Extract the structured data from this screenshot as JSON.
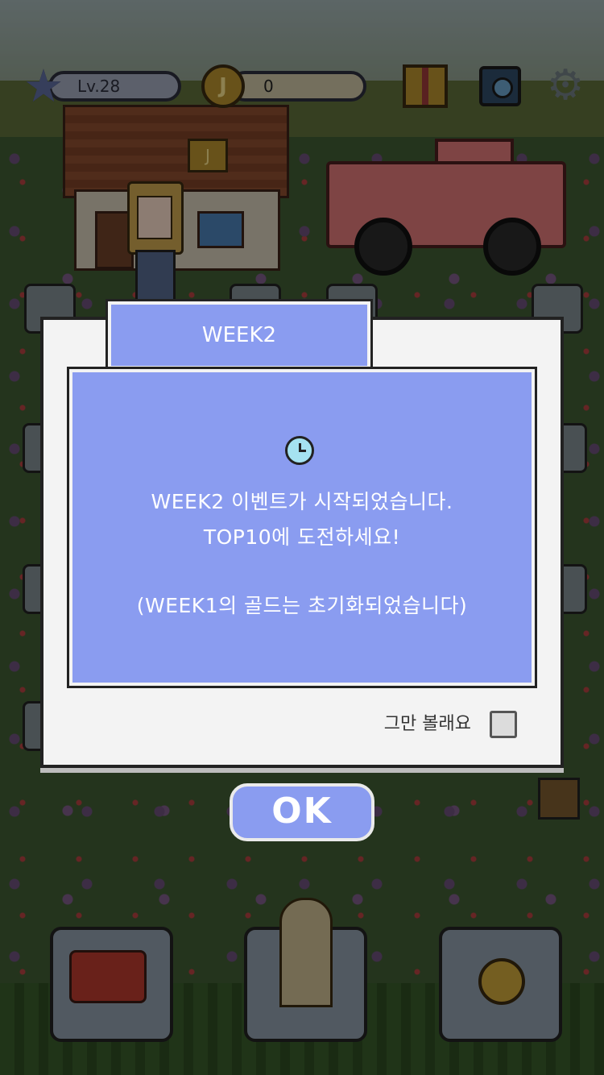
{
  "hud": {
    "level": "Lv.28",
    "gold_symbol": "J",
    "gold_amount": "0"
  },
  "house": {
    "sign_symbol": "J"
  },
  "dialog": {
    "tab_title": "WEEK2",
    "line1": "WEEK2 이벤트가 시작되었습니다.",
    "line2": "TOP10에 도전하세요!",
    "line3": "(WEEK1의 골드는 초기화되었습니다)",
    "dont_show_label": "그만 볼래요",
    "dont_show_checked": false,
    "ok_label": "OK"
  },
  "colors": {
    "panel": "#8a9cf0",
    "dialog_bg": "#f3f3f3",
    "overlay": "rgba(0,0,0,0.42)"
  },
  "bottom_bar": {
    "items": [
      "watering-can-icon",
      "flower-bouquet-icon",
      "medal-icon"
    ]
  }
}
